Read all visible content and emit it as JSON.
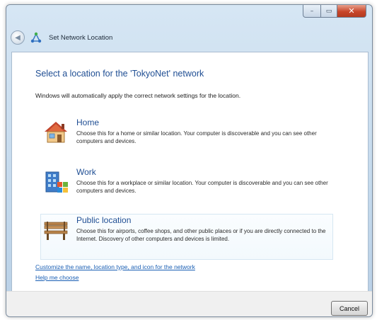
{
  "window": {
    "title": "Set Network Location",
    "controls": {
      "minimize": "–",
      "maximize": "▭",
      "close": "✕"
    }
  },
  "nav": {
    "back_icon": "back-arrow-icon",
    "app_icon": "network-icon"
  },
  "main": {
    "heading": "Select a location for the 'TokyoNet' network",
    "description": "Windows will automatically apply the correct network settings for the location.",
    "options": [
      {
        "title": "Home",
        "description": "Choose this for a home or similar location. Your computer is discoverable and you can see other computers and devices.",
        "icon": "home-icon"
      },
      {
        "title": "Work",
        "description": "Choose this for a workplace or similar location. Your computer is discoverable and you can see other computers and devices.",
        "icon": "work-building-icon"
      },
      {
        "title": "Public location",
        "description": "Choose this for airports, coffee shops, and other public places or if you are directly connected to the Internet. Discovery of other computers and devices is limited.",
        "icon": "park-bench-icon"
      }
    ],
    "links": {
      "customize": "Customize the name, location type, and icon for the network",
      "help": "Help me choose"
    }
  },
  "footer": {
    "cancel_label": "Cancel"
  },
  "colors": {
    "heading": "#1f4e93",
    "link": "#1a5fb4",
    "frame": "#c4d9ec",
    "close_button": "#c8462a"
  }
}
